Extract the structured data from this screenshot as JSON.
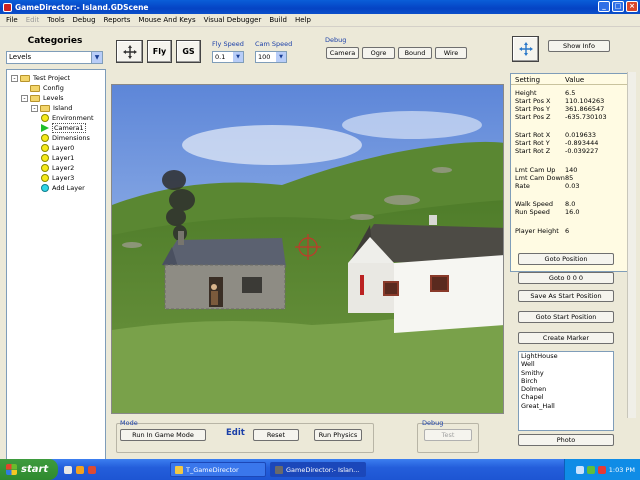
{
  "window": {
    "title": "GameDirector:- Island.GDScene"
  },
  "menu": [
    "File",
    "Edit",
    "Tools",
    "Debug",
    "Reports",
    "Mouse And Keys",
    "Visual Debugger",
    "Build",
    "Help"
  ],
  "menu_disabled": [
    "Edit"
  ],
  "left": {
    "heading": "Categories",
    "category_select": "Levels",
    "tree": [
      {
        "label": "Test Project",
        "icon": "folder-icon",
        "expander": "-"
      },
      {
        "label": "Config",
        "icon": "folder-icon"
      },
      {
        "label": "Levels",
        "icon": "folder-icon",
        "expander": "-"
      },
      {
        "label": "Island",
        "icon": "folder-icon",
        "expander": "-"
      },
      {
        "label": "Environment",
        "icon": "yellow-ball-icon"
      },
      {
        "label": "Camera1",
        "icon": "green-arrow-icon",
        "selected": true
      },
      {
        "label": "Dimensions",
        "icon": "yellow-ball-icon"
      },
      {
        "label": "Layer0",
        "icon": "yellow-ball-icon"
      },
      {
        "label": "Layer1",
        "icon": "yellow-ball-icon"
      },
      {
        "label": "Layer2",
        "icon": "yellow-ball-icon"
      },
      {
        "label": "Layer3",
        "icon": "yellow-ball-icon"
      },
      {
        "label": "Add Layer",
        "icon": "cyan-ball-icon"
      }
    ]
  },
  "toolbar": {
    "fly_label": "Fly",
    "gs_label": "GS",
    "fly_speed_label": "Fly Speed",
    "fly_speed_value": "0.1",
    "cam_speed_label": "Cam Speed",
    "cam_speed_value": "100",
    "debug_label": "Debug",
    "debug_buttons": [
      "Camera",
      "Ogre",
      "Bound",
      "Wire"
    ]
  },
  "bottom": {
    "mode_label": "Mode",
    "run_in_game_mode": "Run In Game Mode",
    "edit_label": "Edit",
    "reset": "Reset",
    "run_physics": "Run Physics",
    "debug_label": "Debug",
    "test": "Test"
  },
  "right": {
    "show_info": "Show Info",
    "table_header": {
      "setting": "Setting",
      "value": "Value"
    },
    "properties": [
      {
        "setting": "Height",
        "value": "6.5"
      },
      {
        "setting": "Start Pos X",
        "value": "110.104263"
      },
      {
        "setting": "Start Pos Y",
        "value": "361.866547"
      },
      {
        "setting": "Start Pos Z",
        "value": "-635.730103"
      },
      {
        "setting": "Start Rot X",
        "value": "0.019633"
      },
      {
        "setting": "Start Rot Y",
        "value": "-0.893444"
      },
      {
        "setting": "Start Rot Z",
        "value": "-0.039227"
      },
      {
        "setting": "Lmt Cam Up",
        "value": "140"
      },
      {
        "setting": "Lmt Cam Down",
        "value": "85"
      },
      {
        "setting": "Rate",
        "value": "0.03"
      },
      {
        "setting": "Walk Speed",
        "value": "8.0"
      },
      {
        "setting": "Run Speed",
        "value": "16.0"
      },
      {
        "setting": "Player Height",
        "value": "6"
      }
    ],
    "buttons": [
      "Goto Position",
      "Goto 0 0 0",
      "Save As Start Position",
      "Goto Start Position",
      "Create Marker"
    ],
    "markers": [
      "LightHouse",
      "Well",
      "Smithy",
      "Birch",
      "Dolmen",
      "Chapel",
      "Great_Hall"
    ],
    "photo": "Photo"
  },
  "taskbar": {
    "start": "start",
    "tasks": [
      "T_GameDirector",
      "GameDirector:- Islan..."
    ],
    "clock": "1:03 PM"
  },
  "colors": {
    "titlebar": "#0543c4",
    "accent_label": "#1a3fa8",
    "property_bg": "#fffbe3",
    "start_green": "#2f8a2f"
  }
}
